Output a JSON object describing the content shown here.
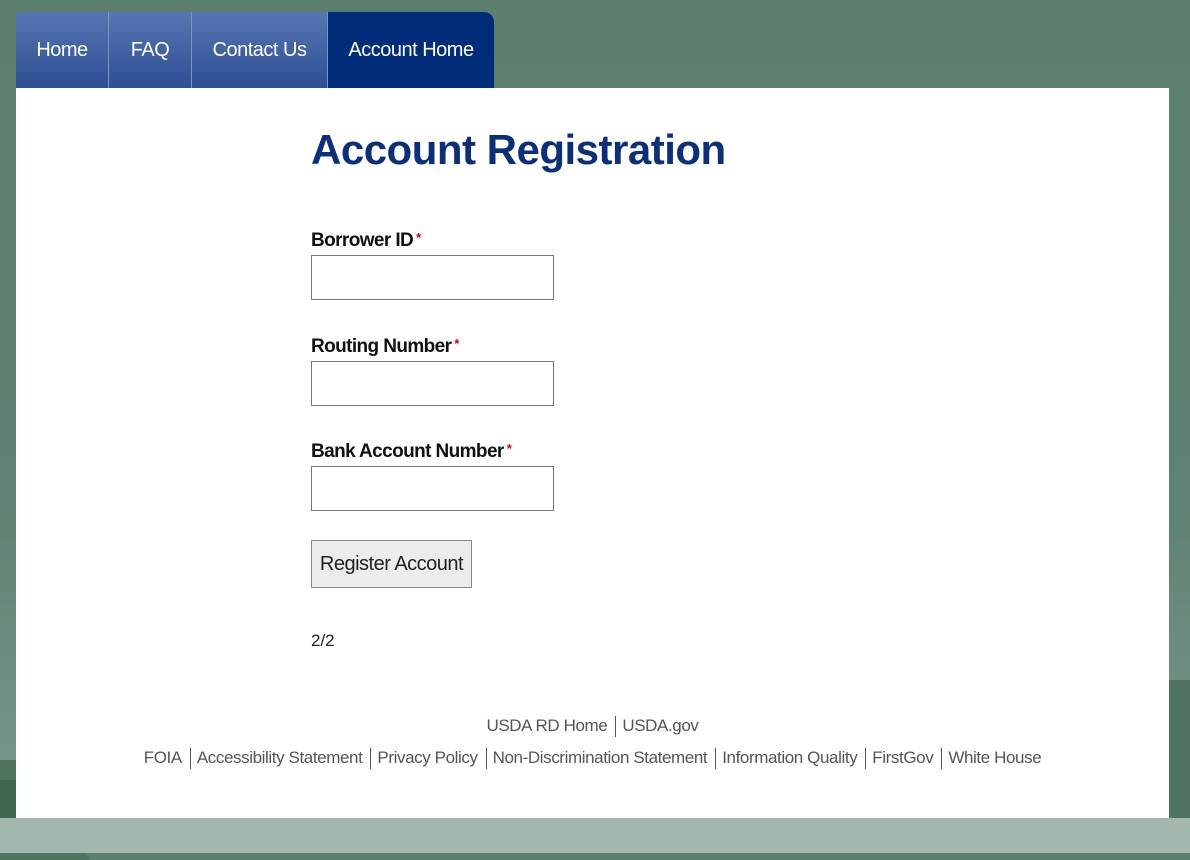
{
  "nav": {
    "tabs": [
      {
        "label": "Home"
      },
      {
        "label": "FAQ"
      },
      {
        "label": "Contact Us"
      },
      {
        "label": "Account Home"
      }
    ]
  },
  "main": {
    "title": "Account Registration",
    "fields": [
      {
        "label": "Borrower ID",
        "required_mark": "*",
        "value": ""
      },
      {
        "label": "Routing Number",
        "required_mark": "*",
        "value": ""
      },
      {
        "label": "Bank Account Number",
        "required_mark": "*",
        "value": ""
      }
    ],
    "register_button": "Register Account",
    "page_indicator": "2/2"
  },
  "footer": {
    "row1": [
      "USDA RD Home",
      "USDA.gov"
    ],
    "row2": [
      "FOIA",
      "Accessibility Statement",
      "Privacy Policy",
      "Non-Discrimination Statement",
      "Information Quality",
      "FirstGov",
      "White House"
    ]
  },
  "colors": {
    "tab_active": "#002c7a",
    "tab_inactive": "#3f5fa3",
    "title": "#0b2f7a",
    "required": "#d0021b"
  }
}
